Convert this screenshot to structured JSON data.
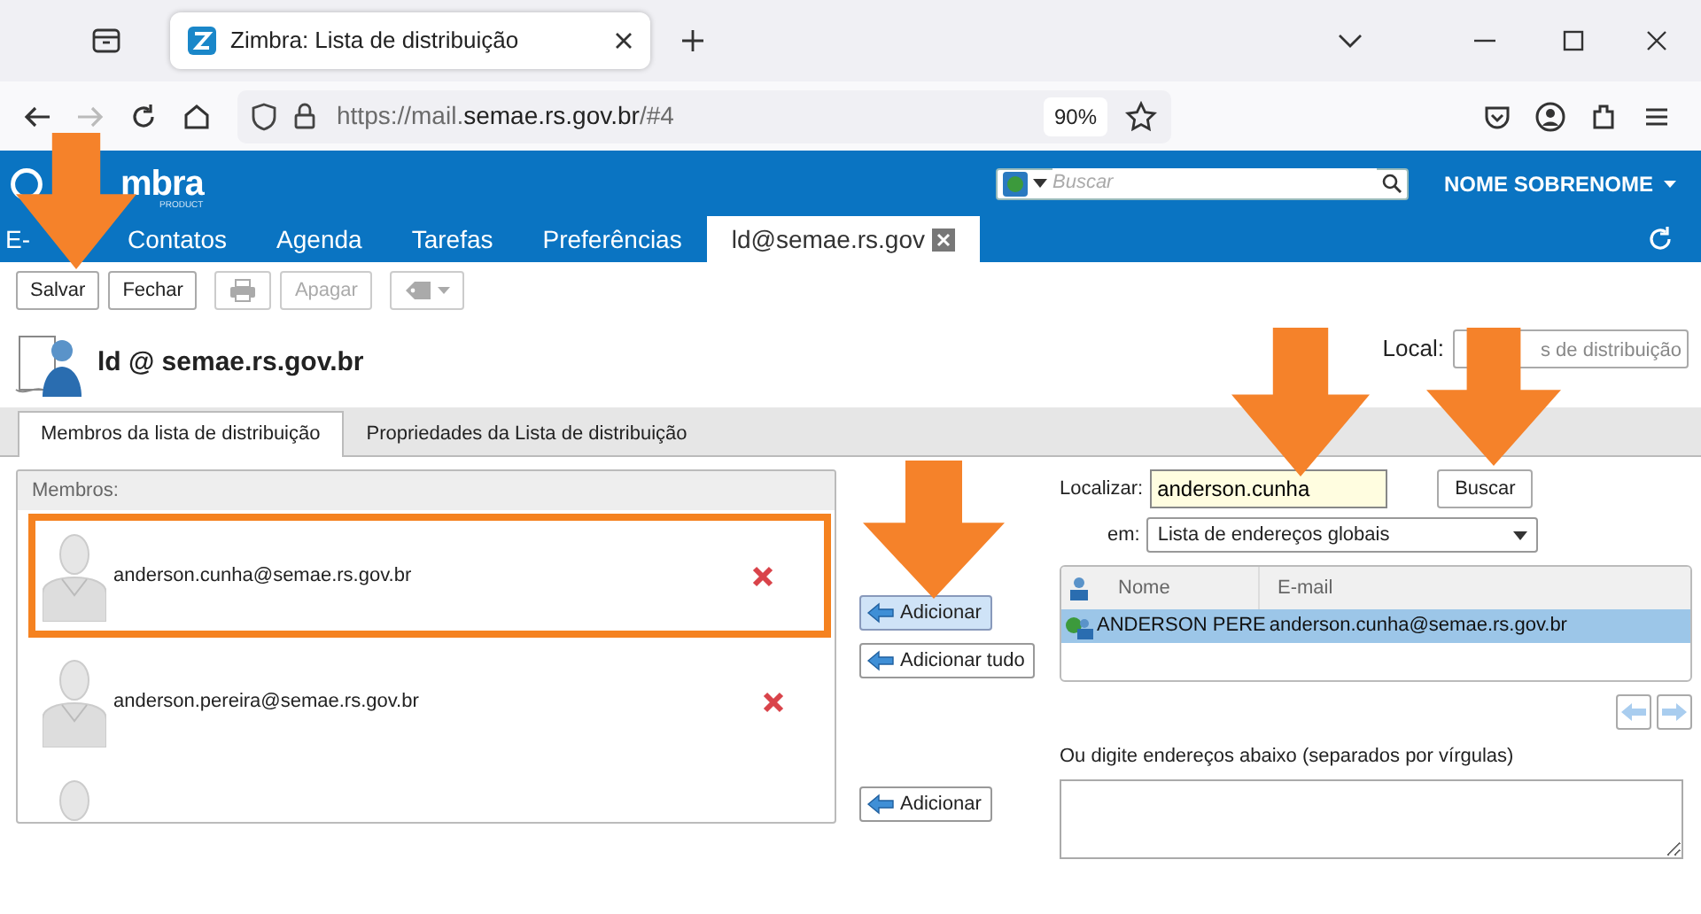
{
  "browser": {
    "tab_title": "Zimbra: Lista de distribuição",
    "url_prefix": "https://mail.",
    "url_host": "semae.rs.gov.br",
    "url_suffix": "/#4",
    "zoom": "90%"
  },
  "app": {
    "logo": "mbra",
    "logo_sub": "PRODUCT",
    "search_placeholder": "Buscar",
    "user": "NOME SOBRENOME"
  },
  "nav": [
    {
      "label": "E-",
      "selected": false,
      "closable": false
    },
    {
      "label": "Contatos",
      "selected": false,
      "closable": false
    },
    {
      "label": "Agenda",
      "selected": false,
      "closable": false
    },
    {
      "label": "Tarefas",
      "selected": false,
      "closable": false
    },
    {
      "label": "Preferências",
      "selected": false,
      "closable": false
    },
    {
      "label": "ld@semae.rs.gov",
      "selected": true,
      "closable": true
    }
  ],
  "toolbar": [
    {
      "kind": "text",
      "label": "Salvar",
      "disabled": false
    },
    {
      "kind": "text",
      "label": "Fechar",
      "disabled": false
    },
    {
      "kind": "print",
      "disabled": true
    },
    {
      "kind": "text",
      "label": "Apagar",
      "disabled": true
    },
    {
      "kind": "tag",
      "disabled": true
    }
  ],
  "header": {
    "title": "ld @ semae.rs.gov.br",
    "local_label": "Local:",
    "local_value": "s de distribuição"
  },
  "tabs": [
    {
      "label": "Membros da lista de distribuição",
      "selected": true
    },
    {
      "label": "Propriedades da Lista de distribuição",
      "selected": false
    }
  ],
  "members": {
    "heading": "Membros:",
    "more_below": true,
    "items": [
      {
        "email": "anderson.cunha@semae.rs.gov.br",
        "highlighted": true
      },
      {
        "email": "anderson.pereira@semae.rs.gov.br",
        "highlighted": false
      }
    ]
  },
  "add_buttons": [
    {
      "label": "Adicionar",
      "active": true
    },
    {
      "label": "Adicionar tudo",
      "active": false
    },
    {
      "label": "Adicionar",
      "active": false
    }
  ],
  "search": {
    "label": "Localizar:",
    "value": "anderson.cunha",
    "button": "Buscar",
    "in_label": "em:",
    "in_value": "Lista de endereços globais"
  },
  "results": {
    "columns": [
      "Nome",
      "E-mail"
    ],
    "rows": [
      {
        "name": "ANDERSON PERE",
        "email": "anderson.cunha@semae.rs.gov.br",
        "selected": true
      }
    ]
  },
  "pager": {
    "prev_disabled": true,
    "next_disabled": true
  },
  "manual": {
    "label": "Ou digite endereços abaixo (separados por vírgulas)"
  }
}
